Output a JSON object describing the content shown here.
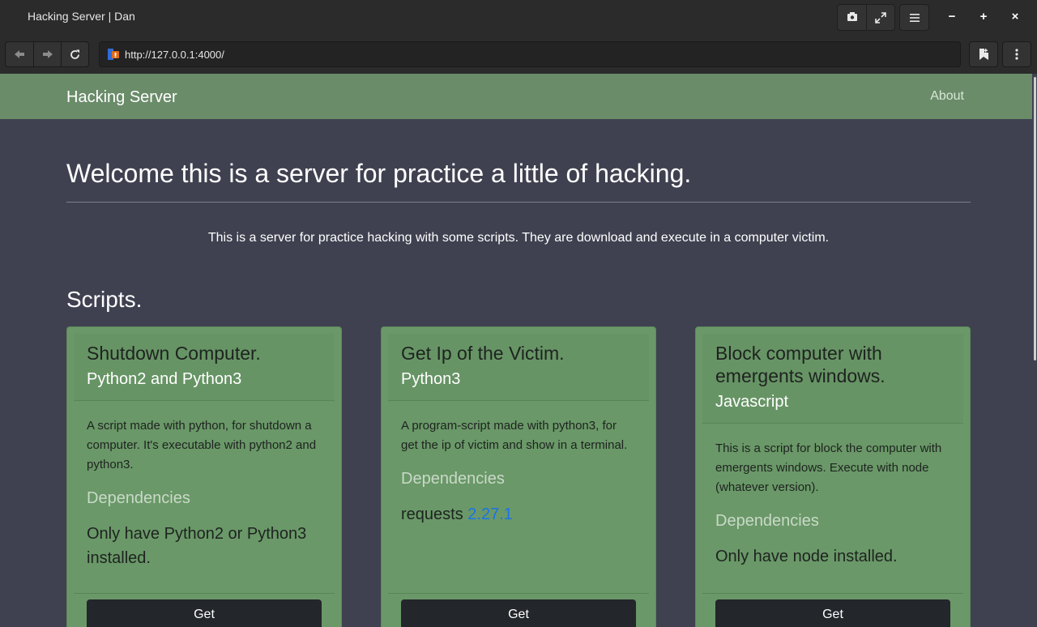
{
  "window": {
    "title": "Hacking Server | Dan",
    "controls": {
      "minimize": "−",
      "maximize": "+",
      "close": "×"
    }
  },
  "toolbar": {
    "url": "http://127.0.0.1:4000/"
  },
  "site": {
    "brand": "Hacking Server",
    "nav_about": "About",
    "heading": "Welcome this is a server for practice a little of hacking.",
    "lead": "This is a server for practice hacking with some scripts. They are download and execute in a computer victim.",
    "section_title": "Scripts."
  },
  "cards": [
    {
      "title": "Shutdown Computer.",
      "subtitle": "Python2 and Python3",
      "description": "A script made with python, for shutdown a computer. It's executable with python2 and python3.",
      "deps_title": "Dependencies",
      "deps_text": "Only have Python2 or Python3 installed.",
      "button": "Get"
    },
    {
      "title": "Get Ip of the Victim.",
      "subtitle": "Python3",
      "description": "A program-script made with python3, for get the ip of victim and show in a terminal.",
      "deps_title": "Dependencies",
      "deps_text": "requests ",
      "deps_version": "2.27.1",
      "button": "Get"
    },
    {
      "title": "Block computer with emergents windows.",
      "subtitle": "Javascript",
      "description": "This is a script for block the computer with emergents windows. Execute with node (whatever version).",
      "deps_title": "Dependencies",
      "deps_text": "Only have node installed.",
      "button": "Get"
    }
  ]
}
